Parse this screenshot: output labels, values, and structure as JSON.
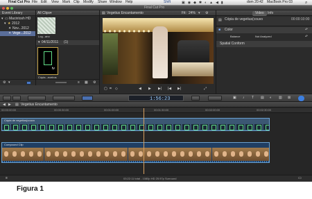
{
  "menubar": {
    "apple": "",
    "app": "Final Cut Pro",
    "items": [
      "File",
      "Edit",
      "View",
      "Mark",
      "Clip",
      "Modify",
      "Share",
      "Window",
      "Help"
    ],
    "shift": "Shift",
    "right": [
      "dom 20:42",
      "MacBook Pro 03"
    ]
  },
  "window": {
    "title": "Final Cut Pro"
  },
  "library": {
    "header": "Event Library",
    "items": [
      {
        "label": "Macintosh HD",
        "selected": false
      },
      {
        "label": "2012",
        "selected": false
      },
      {
        "label": "Nov...2012",
        "selected": false
      },
      {
        "label": "Vege...2012",
        "selected": true
      }
    ]
  },
  "browser": {
    "header": "All Clips",
    "clip1_label": "Log...ano",
    "group_label": "04/11/2011",
    "group_count": "(1)",
    "clip2_label": "Cópia...eceiros",
    "clip2_badge": "tv"
  },
  "viewer": {
    "title": "Vegetius Encantamento",
    "fit_label": "Fit:",
    "fit_value": "24%"
  },
  "inspector": {
    "tabs": [
      "Video",
      "Info"
    ],
    "clip_name": "Cópia de vegetius(couvo",
    "timecode": "00:00:10:00",
    "section_color": "Color",
    "balance_label": "Balance",
    "balance_value": "Not Analyzed",
    "section_spatial": "Spatial Conform"
  },
  "toolbar": {
    "timecode": "1:56:23"
  },
  "timeline": {
    "title": "Vegetius Encantamento",
    "ruler": [
      "00:00:00:00",
      "00:00:30:00",
      "00:01:00:00",
      "00:01:30:00",
      "00:02:00:00",
      "00:02:30:00"
    ],
    "track1_label": "Cópia de vegetius(couvo",
    "track2_label": "Compound Clip",
    "status": "03:22:11 total - 1080p HD 25.97p Surround"
  },
  "caption": "Figura 1"
}
